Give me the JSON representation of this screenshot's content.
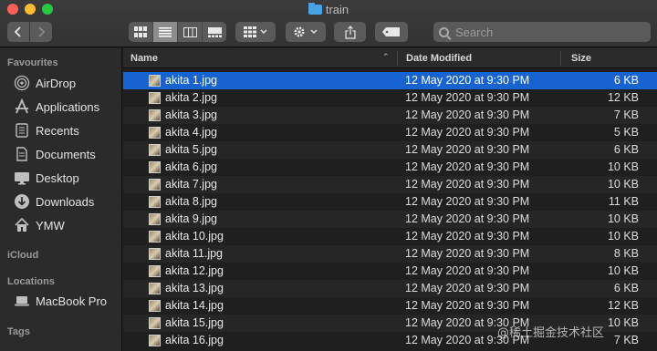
{
  "window": {
    "title": "train"
  },
  "toolbar": {
    "back_icon": "chevron-left-icon",
    "forward_icon": "chevron-right-icon",
    "search_placeholder": "Search"
  },
  "sidebar": {
    "favourites_label": "Favourites",
    "favourites": [
      {
        "label": "AirDrop",
        "icon": "airdrop-icon"
      },
      {
        "label": "Applications",
        "icon": "applications-icon"
      },
      {
        "label": "Recents",
        "icon": "recents-icon"
      },
      {
        "label": "Documents",
        "icon": "documents-icon"
      },
      {
        "label": "Desktop",
        "icon": "desktop-icon"
      },
      {
        "label": "Downloads",
        "icon": "downloads-icon"
      },
      {
        "label": "YMW",
        "icon": "home-icon"
      }
    ],
    "icloud_label": "iCloud",
    "locations_label": "Locations",
    "locations": [
      {
        "label": "MacBook Pro",
        "icon": "laptop-icon"
      }
    ],
    "tags_label": "Tags"
  },
  "columns": {
    "name": "Name",
    "date": "Date Modified",
    "size": "Size"
  },
  "files": [
    {
      "name": "akita 1.jpg",
      "date": "12 May 2020 at 9:30 PM",
      "size": "6 KB",
      "selected": true
    },
    {
      "name": "akita 2.jpg",
      "date": "12 May 2020 at 9:30 PM",
      "size": "12 KB"
    },
    {
      "name": "akita 3.jpg",
      "date": "12 May 2020 at 9:30 PM",
      "size": "7 KB"
    },
    {
      "name": "akita 4.jpg",
      "date": "12 May 2020 at 9:30 PM",
      "size": "5 KB"
    },
    {
      "name": "akita 5.jpg",
      "date": "12 May 2020 at 9:30 PM",
      "size": "6 KB"
    },
    {
      "name": "akita 6.jpg",
      "date": "12 May 2020 at 9:30 PM",
      "size": "10 KB"
    },
    {
      "name": "akita 7.jpg",
      "date": "12 May 2020 at 9:30 PM",
      "size": "10 KB"
    },
    {
      "name": "akita 8.jpg",
      "date": "12 May 2020 at 9:30 PM",
      "size": "11 KB"
    },
    {
      "name": "akita 9.jpg",
      "date": "12 May 2020 at 9:30 PM",
      "size": "10 KB"
    },
    {
      "name": "akita 10.jpg",
      "date": "12 May 2020 at 9:30 PM",
      "size": "10 KB"
    },
    {
      "name": "akita 11.jpg",
      "date": "12 May 2020 at 9:30 PM",
      "size": "8 KB"
    },
    {
      "name": "akita 12.jpg",
      "date": "12 May 2020 at 9:30 PM",
      "size": "10 KB"
    },
    {
      "name": "akita 13.jpg",
      "date": "12 May 2020 at 9:30 PM",
      "size": "6 KB"
    },
    {
      "name": "akita 14.jpg",
      "date": "12 May 2020 at 9:30 PM",
      "size": "12 KB"
    },
    {
      "name": "akita 15.jpg",
      "date": "12 May 2020 at 9:30 PM",
      "size": "10 KB"
    },
    {
      "name": "akita 16.jpg",
      "date": "12 May 2020 at 9:30 PM",
      "size": "7 KB"
    }
  ],
  "watermark": "@稀土掘金技术社区",
  "colors": {
    "selection": "#1663d1",
    "folder": "#4aa2e6"
  }
}
